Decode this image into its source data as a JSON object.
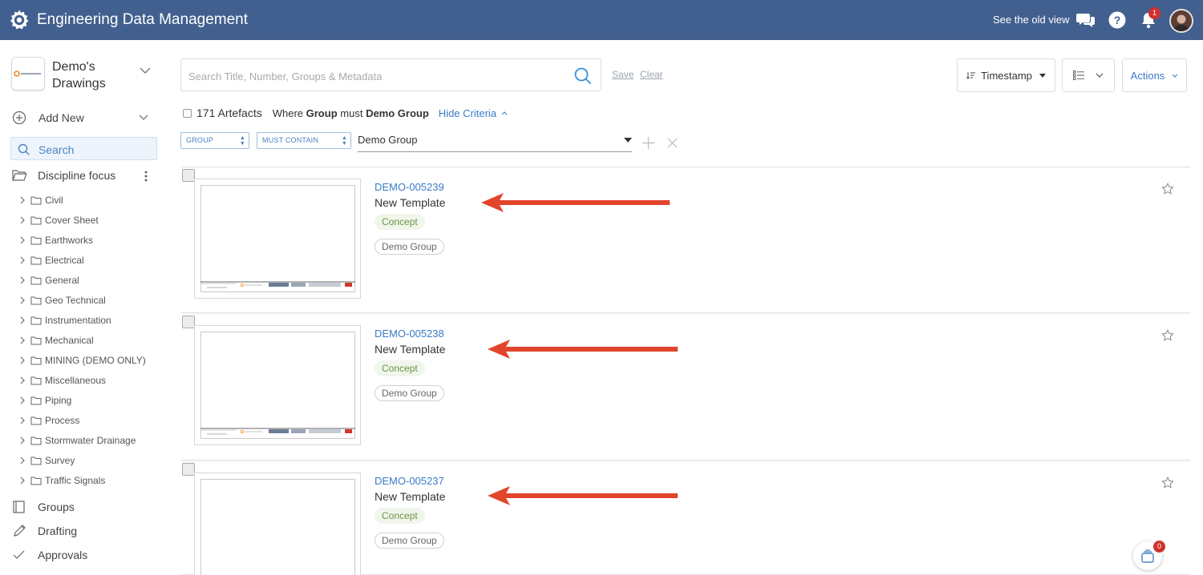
{
  "header": {
    "title": "Engineering Data Management",
    "old_view": "See the old view",
    "notification_count": "1",
    "icons": [
      "gear-logo-icon",
      "chat-icon",
      "help-icon",
      "bell-icon",
      "avatar"
    ]
  },
  "sidebar": {
    "project_name": "Demo's Drawings",
    "add_new": "Add New",
    "search": "Search",
    "discipline": "Discipline focus",
    "tree": [
      "Civil",
      "Cover Sheet",
      "Earthworks",
      "Electrical",
      "General",
      "Geo Technical",
      "Instrumentation",
      "Mechanical",
      "MINING (DEMO ONLY)",
      "Miscellaneous",
      "Piping",
      "Process",
      "Stormwater Drainage",
      "Survey",
      "Traffic Signals"
    ],
    "groups": "Groups",
    "drafting": "Drafting",
    "approvals": "Approvals"
  },
  "search": {
    "placeholder": "Search Title, Number, Groups & Metadata",
    "save": "Save",
    "clear": "Clear"
  },
  "toolbar": {
    "sort_label": "Timestamp",
    "actions_label": "Actions"
  },
  "filter": {
    "count": "171 Artefacts",
    "where_prefix": "Where",
    "field": "Group",
    "operator_text": "must",
    "value_bold": "Demo Group",
    "hide_criteria": "Hide Criteria",
    "field_select": "GROUP",
    "operator_select": "MUST CONTAIN",
    "value": "Demo Group"
  },
  "results": [
    {
      "number": "DEMO-005239",
      "title": "New Template",
      "status": "Concept",
      "group": "Demo Group"
    },
    {
      "number": "DEMO-005238",
      "title": "New Template",
      "status": "Concept",
      "group": "Demo Group"
    },
    {
      "number": "DEMO-005237",
      "title": "New Template",
      "status": "Concept",
      "group": "Demo Group"
    }
  ],
  "basket_count": "0",
  "colors": {
    "header_bg": "#42608f",
    "link": "#3a7bc6",
    "arrow": "#e2452b",
    "concept_text": "#6d9443"
  }
}
